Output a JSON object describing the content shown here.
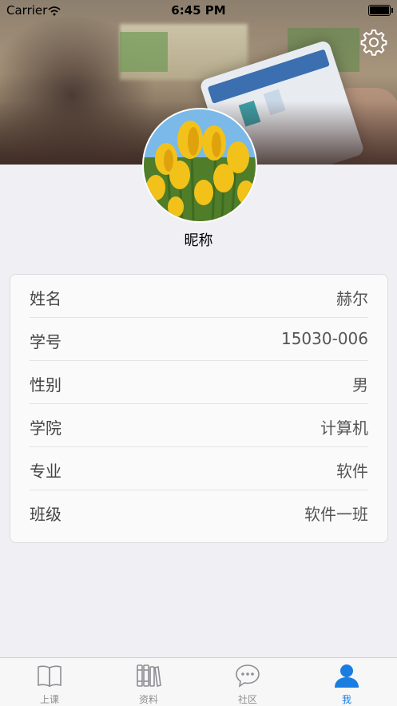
{
  "status_bar": {
    "carrier": "Carrier",
    "time": "6:45 PM"
  },
  "profile": {
    "nickname": "昵称"
  },
  "info_rows": [
    {
      "label": "姓名",
      "value": "赫尔"
    },
    {
      "label": "学号",
      "value": "15030-006"
    },
    {
      "label": "性别",
      "value": "男"
    },
    {
      "label": "学院",
      "value": "计算机"
    },
    {
      "label": "专业",
      "value": "软件"
    },
    {
      "label": "班级",
      "value": "软件一班"
    }
  ],
  "tabs": [
    {
      "label": "上课",
      "icon": "book-icon"
    },
    {
      "label": "资料",
      "icon": "library-icon"
    },
    {
      "label": "社区",
      "icon": "chat-bubble-icon"
    },
    {
      "label": "我",
      "icon": "person-icon",
      "active": true
    }
  ],
  "colors": {
    "accent": "#1a7ee0",
    "background": "#efeff4"
  }
}
